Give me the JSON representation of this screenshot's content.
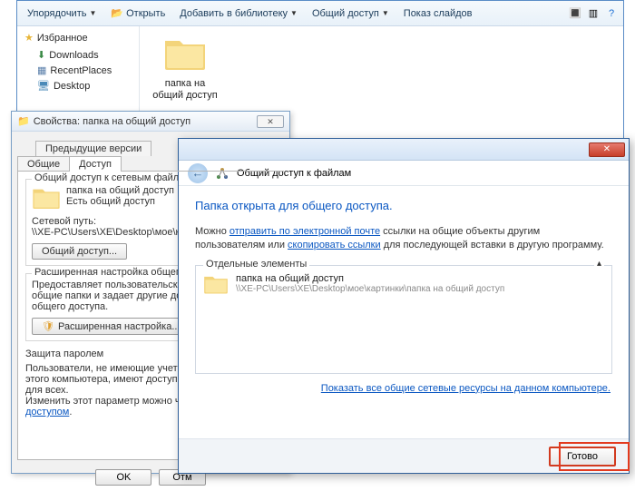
{
  "explorer": {
    "toolbar": {
      "organize": "Упорядочить",
      "open": "Открыть",
      "addToLibrary": "Добавить в библиотеку",
      "share": "Общий доступ",
      "slideshow": "Показ слайдов"
    },
    "favorites": {
      "title": "Избранное",
      "items": [
        "Downloads",
        "RecentPlaces",
        "Desktop"
      ]
    },
    "folder": {
      "name": "папка на общий доступ"
    }
  },
  "props": {
    "title": "Свойства: папка на общий доступ",
    "tabs": {
      "prevVersions": "Предыдущие версии",
      "general": "Общие",
      "access": "Доступ"
    },
    "group1": {
      "title": "Общий доступ к сетевым файлам и п",
      "folderName": "папка на общий доступ",
      "shared": "Есть общий доступ",
      "netPathLabel": "Сетевой путь:",
      "netPath": "\\\\XE-PC\\Users\\XE\\Desktop\\мое\\карти",
      "shareBtn": "Общий доступ..."
    },
    "group2": {
      "title": "Расширенная настройка общего дост",
      "desc": "Предоставляет пользовательские ра\nобщие папки и задает другие дополн\nобщего доступа.",
      "btn": "Расширенная настройка..."
    },
    "group3": {
      "title": "Защита паролем",
      "desc": "Пользователи, не имеющие учетной з\nэтого компьютера, имеют доступ к п\nдля всех.",
      "linkPrefix": "Изменить этот параметр можно чере",
      "link": "сетями и общим доступом"
    },
    "buttons": {
      "ok": "OK",
      "cancel": "Отм"
    }
  },
  "wizard": {
    "header": "Общий доступ к файлам",
    "heading": "Папка открыта для общего доступа.",
    "descPrefix": "Можно ",
    "emailLink": "отправить по электронной почте",
    "descMid": " ссылки на общие объекты другим пользователям или ",
    "copyLink": "скопировать ссылки",
    "descSuffix": " для последующей вставки в другую программу.",
    "group": {
      "title": "Отдельные элементы",
      "item": {
        "name": "папка на общий доступ",
        "path": "\\\\XE-PC\\Users\\XE\\Desktop\\мое\\картинки\\папка на общий доступ"
      }
    },
    "bottomLink": "Показать все общие сетевые ресурсы на данном компьютере.",
    "done": "Готово"
  }
}
